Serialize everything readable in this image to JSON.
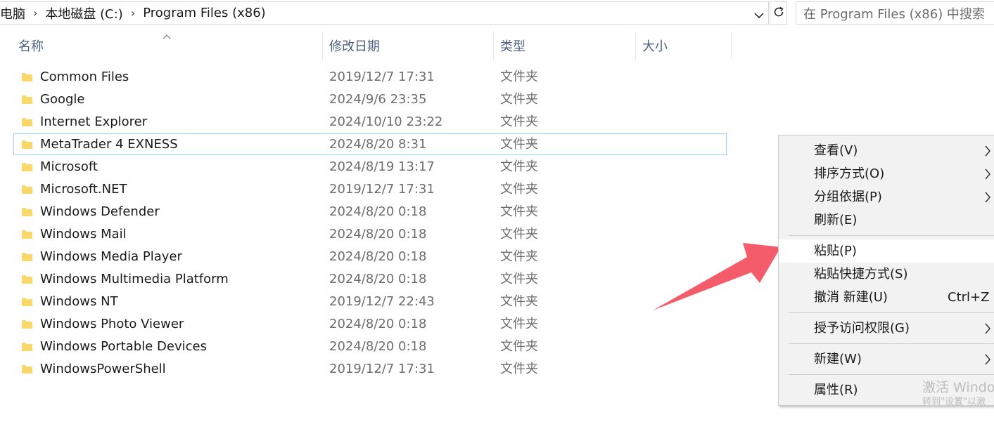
{
  "address": {
    "crumbs": [
      "电脑",
      "本地磁盘 (C:)",
      "Program Files (x86)"
    ]
  },
  "search": {
    "placeholder": "在 Program Files (x86) 中搜索"
  },
  "columns": {
    "name": "名称",
    "date": "修改日期",
    "type": "类型",
    "size": "大小"
  },
  "files": [
    {
      "name": "Common Files",
      "date": "2019/12/7 17:31",
      "type": "文件夹"
    },
    {
      "name": "Google",
      "date": "2024/9/6 23:35",
      "type": "文件夹"
    },
    {
      "name": "Internet Explorer",
      "date": "2024/10/10 23:22",
      "type": "文件夹"
    },
    {
      "name": "MetaTrader 4 EXNESS",
      "date": "2024/8/20 8:31",
      "type": "文件夹"
    },
    {
      "name": "Microsoft",
      "date": "2024/8/19 13:17",
      "type": "文件夹"
    },
    {
      "name": "Microsoft.NET",
      "date": "2019/12/7 17:31",
      "type": "文件夹"
    },
    {
      "name": "Windows Defender",
      "date": "2024/8/20 0:18",
      "type": "文件夹"
    },
    {
      "name": "Windows Mail",
      "date": "2024/8/20 0:18",
      "type": "文件夹"
    },
    {
      "name": "Windows Media Player",
      "date": "2024/8/20 0:18",
      "type": "文件夹"
    },
    {
      "name": "Windows Multimedia Platform",
      "date": "2024/8/20 0:18",
      "type": "文件夹"
    },
    {
      "name": "Windows NT",
      "date": "2019/12/7 22:43",
      "type": "文件夹"
    },
    {
      "name": "Windows Photo Viewer",
      "date": "2024/8/20 0:18",
      "type": "文件夹"
    },
    {
      "name": "Windows Portable Devices",
      "date": "2024/8/20 0:18",
      "type": "文件夹"
    },
    {
      "name": "WindowsPowerShell",
      "date": "2019/12/7 17:31",
      "type": "文件夹"
    }
  ],
  "context_menu": {
    "view": "查看(V)",
    "sort": "排序方式(O)",
    "group": "分组依据(P)",
    "refresh": "刷新(E)",
    "paste": "粘贴(P)",
    "paste_shortcut": "粘贴快捷方式(S)",
    "undo": "撤消 新建(U)",
    "undo_shortcut": "Ctrl+Z",
    "grant_access": "授予访问权限(G)",
    "new": "新建(W)",
    "properties": "属性(R)"
  },
  "watermark": {
    "line1": "激活 Windo",
    "line2": "转到\"设置\"以激"
  },
  "colors": {
    "folder": "#f8d775",
    "selection_border": "#99d1f6",
    "annotation_arrow": "#f45b6b"
  }
}
